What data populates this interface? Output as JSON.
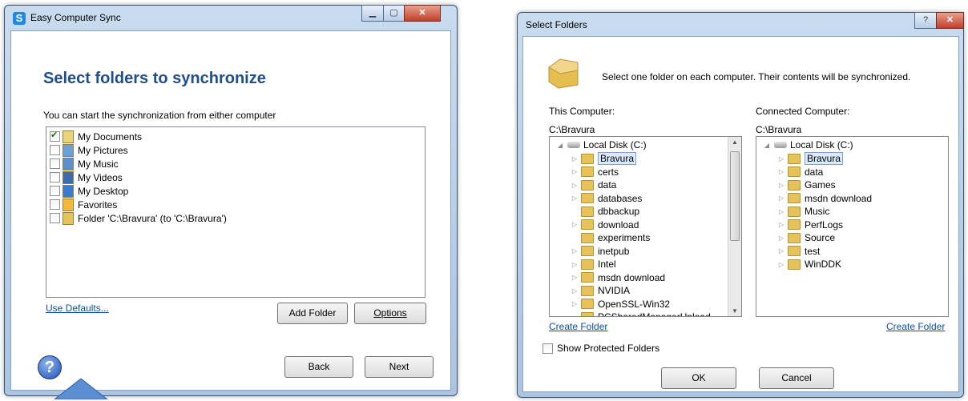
{
  "left_window": {
    "title": "Easy Computer Sync",
    "heading": "Select folders to synchronize",
    "subtitle": "You can start the synchronization from either computer",
    "folders": [
      {
        "label": "My Documents",
        "checked": true,
        "icon": "documents-icon"
      },
      {
        "label": "My Pictures",
        "checked": false,
        "icon": "pictures-icon"
      },
      {
        "label": "My Music",
        "checked": false,
        "icon": "music-icon"
      },
      {
        "label": "My Videos",
        "checked": false,
        "icon": "videos-icon"
      },
      {
        "label": "My Desktop",
        "checked": false,
        "icon": "desktop-icon"
      },
      {
        "label": "Favorites",
        "checked": false,
        "icon": "favorites-icon"
      },
      {
        "label": "Folder 'C:\\Bravura' (to 'C:\\Bravura')",
        "checked": false,
        "icon": "folder-icon"
      }
    ],
    "use_defaults": "Use Defaults...",
    "add_folder": "Add Folder",
    "options": "Options",
    "back": "Back",
    "next": "Next",
    "help": "?"
  },
  "right_window": {
    "title": "Select Folders",
    "instruction": "Select one folder on each computer.  Their contents will be synchronized.",
    "this_computer_label": "This Computer:",
    "this_computer_path": "C:\\Bravura",
    "connected_computer_label": "Connected Computer:",
    "connected_computer_path": "C:\\Bravura",
    "drive_label": "Local Disk (C:)",
    "left_tree": [
      {
        "label": "Bravura",
        "expandable": true,
        "selected": true
      },
      {
        "label": "certs",
        "expandable": true
      },
      {
        "label": "data",
        "expandable": true
      },
      {
        "label": "databases",
        "expandable": true
      },
      {
        "label": "dbbackup",
        "expandable": false
      },
      {
        "label": "download",
        "expandable": true
      },
      {
        "label": "experiments",
        "expandable": false
      },
      {
        "label": "inetpub",
        "expandable": true
      },
      {
        "label": "Intel",
        "expandable": true
      },
      {
        "label": "msdn download",
        "expandable": true
      },
      {
        "label": "NVIDIA",
        "expandable": true
      },
      {
        "label": "OpenSSL-Win32",
        "expandable": true
      },
      {
        "label": "PCSharedManagerUpload",
        "expandable": false
      }
    ],
    "right_tree": [
      {
        "label": "Bravura",
        "expandable": true,
        "selected": true
      },
      {
        "label": "data",
        "expandable": true
      },
      {
        "label": "Games",
        "expandable": true
      },
      {
        "label": "msdn download",
        "expandable": true
      },
      {
        "label": "Music",
        "expandable": true
      },
      {
        "label": "PerfLogs",
        "expandable": true
      },
      {
        "label": "Source",
        "expandable": true
      },
      {
        "label": "test",
        "expandable": true
      },
      {
        "label": "WinDDK",
        "expandable": true
      }
    ],
    "create_folder_left": "Create Folder",
    "create_folder_right": "Create Folder",
    "show_protected": "Show Protected Folders",
    "ok": "OK",
    "cancel": "Cancel",
    "help": "?"
  }
}
